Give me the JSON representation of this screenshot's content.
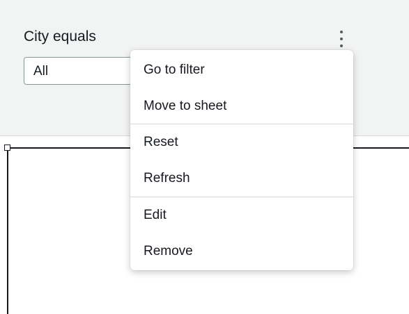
{
  "filter": {
    "label": "City equals",
    "selected_value": "All",
    "more_icon": "more-vertical-icon"
  },
  "menu": {
    "items": [
      {
        "label": "Go to filter"
      },
      {
        "label": "Move to sheet"
      },
      {
        "label": "Reset"
      },
      {
        "label": "Refresh"
      },
      {
        "label": "Edit"
      },
      {
        "label": "Remove"
      }
    ]
  },
  "colors": {
    "panel_background": "#f2f3f3",
    "text": "#16191f",
    "divider": "#d5dbdb"
  }
}
